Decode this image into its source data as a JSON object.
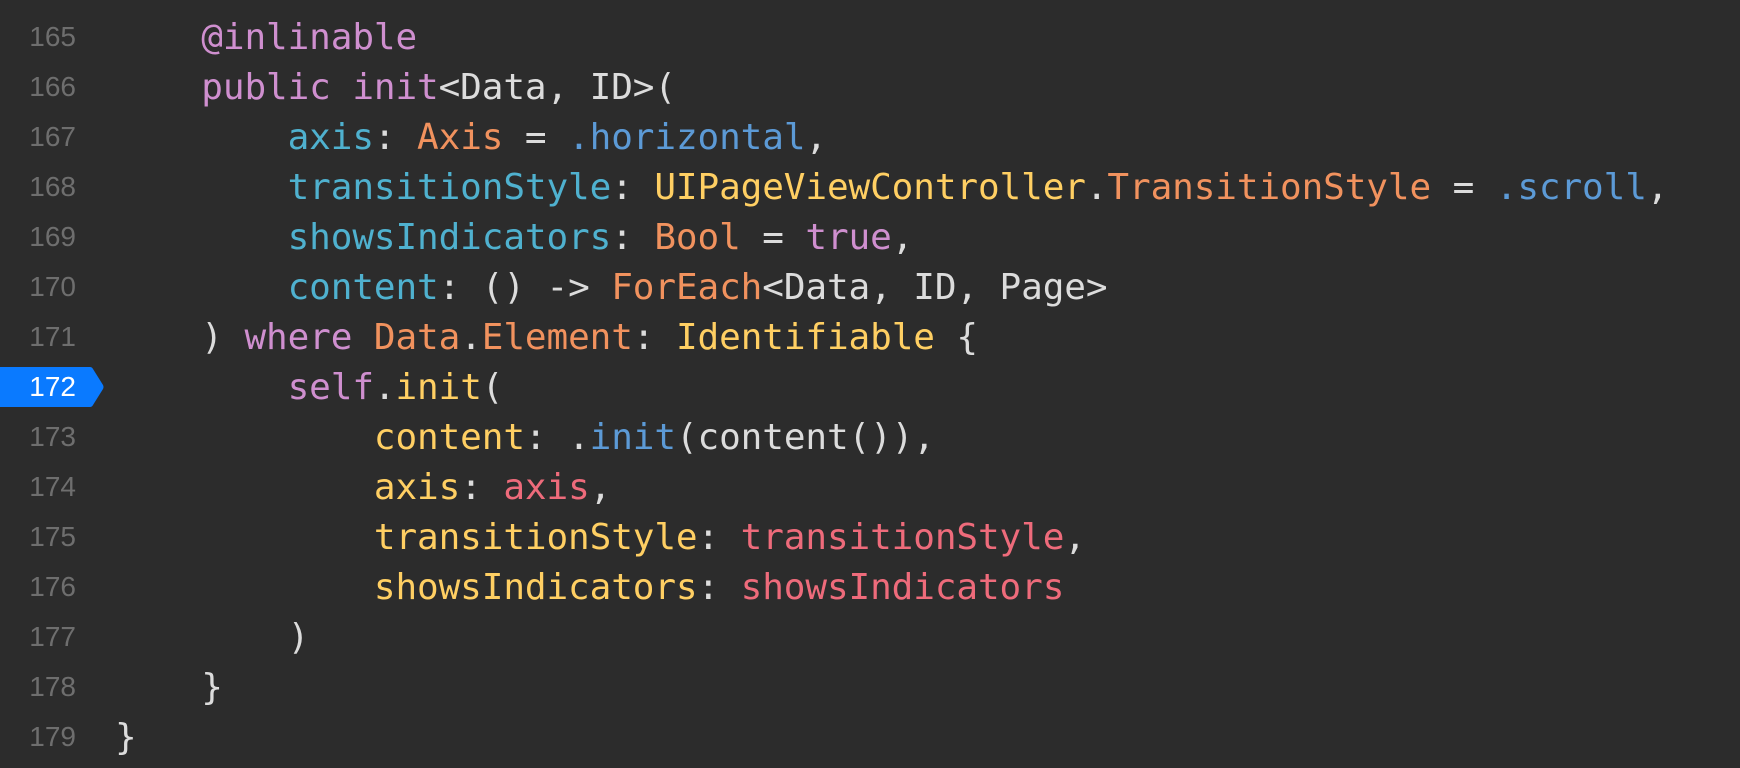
{
  "editor": {
    "active_line": 172,
    "colors": {
      "background": "#2c2c2c",
      "breakpoint": "#0a7aff"
    },
    "lines": [
      {
        "num": "165",
        "tokens": [
          [
            "plain",
            "    "
          ],
          [
            "kw",
            "@inlinable"
          ]
        ]
      },
      {
        "num": "166",
        "tokens": [
          [
            "plain",
            "    "
          ],
          [
            "kw",
            "public init"
          ],
          [
            "plain",
            "<Data, ID>("
          ]
        ]
      },
      {
        "num": "167",
        "tokens": [
          [
            "plain",
            "        "
          ],
          [
            "param",
            "axis"
          ],
          [
            "plain",
            ": "
          ],
          [
            "type",
            "Axis"
          ],
          [
            "plain",
            " = "
          ],
          [
            "enum",
            ".horizontal"
          ],
          [
            "plain",
            ","
          ]
        ]
      },
      {
        "num": "168",
        "tokens": [
          [
            "plain",
            "        "
          ],
          [
            "param",
            "transitionStyle"
          ],
          [
            "plain",
            ": "
          ],
          [
            "cls",
            "UIPageViewController"
          ],
          [
            "plain",
            "."
          ],
          [
            "type",
            "TransitionStyle"
          ],
          [
            "plain",
            " = "
          ],
          [
            "enum",
            ".scroll"
          ],
          [
            "plain",
            ","
          ]
        ]
      },
      {
        "num": "169",
        "tokens": [
          [
            "plain",
            "        "
          ],
          [
            "param",
            "showsIndicators"
          ],
          [
            "plain",
            ": "
          ],
          [
            "type",
            "Bool"
          ],
          [
            "plain",
            " = "
          ],
          [
            "kw",
            "true"
          ],
          [
            "plain",
            ","
          ]
        ]
      },
      {
        "num": "170",
        "tokens": [
          [
            "plain",
            "        "
          ],
          [
            "param",
            "content"
          ],
          [
            "plain",
            ": () -> "
          ],
          [
            "type",
            "ForEach"
          ],
          [
            "plain",
            "<Data, ID, Page>"
          ]
        ]
      },
      {
        "num": "171",
        "tokens": [
          [
            "plain",
            "    ) "
          ],
          [
            "kw",
            "where"
          ],
          [
            "plain",
            " "
          ],
          [
            "type",
            "Data"
          ],
          [
            "plain",
            "."
          ],
          [
            "type",
            "Element"
          ],
          [
            "plain",
            ": "
          ],
          [
            "cls",
            "Identifiable"
          ],
          [
            "plain",
            " {"
          ]
        ]
      },
      {
        "num": "172",
        "tokens": [
          [
            "plain",
            "        "
          ],
          [
            "kw",
            "self"
          ],
          [
            "plain",
            "."
          ],
          [
            "cls",
            "init"
          ],
          [
            "plain",
            "("
          ]
        ]
      },
      {
        "num": "173",
        "tokens": [
          [
            "plain",
            "            "
          ],
          [
            "cls",
            "content"
          ],
          [
            "plain",
            ": ."
          ],
          [
            "enum",
            "init"
          ],
          [
            "plain",
            "(content()),"
          ]
        ]
      },
      {
        "num": "174",
        "tokens": [
          [
            "plain",
            "            "
          ],
          [
            "cls",
            "axis"
          ],
          [
            "plain",
            ": "
          ],
          [
            "var",
            "axis"
          ],
          [
            "plain",
            ","
          ]
        ]
      },
      {
        "num": "175",
        "tokens": [
          [
            "plain",
            "            "
          ],
          [
            "cls",
            "transitionStyle"
          ],
          [
            "plain",
            ": "
          ],
          [
            "var",
            "transitionStyle"
          ],
          [
            "plain",
            ","
          ]
        ]
      },
      {
        "num": "176",
        "tokens": [
          [
            "plain",
            "            "
          ],
          [
            "cls",
            "showsIndicators"
          ],
          [
            "plain",
            ": "
          ],
          [
            "var",
            "showsIndicators"
          ]
        ]
      },
      {
        "num": "177",
        "tokens": [
          [
            "plain",
            "        )"
          ]
        ]
      },
      {
        "num": "178",
        "tokens": [
          [
            "plain",
            "    }"
          ]
        ]
      },
      {
        "num": "179",
        "tokens": [
          [
            "plain",
            "}"
          ]
        ]
      }
    ]
  }
}
